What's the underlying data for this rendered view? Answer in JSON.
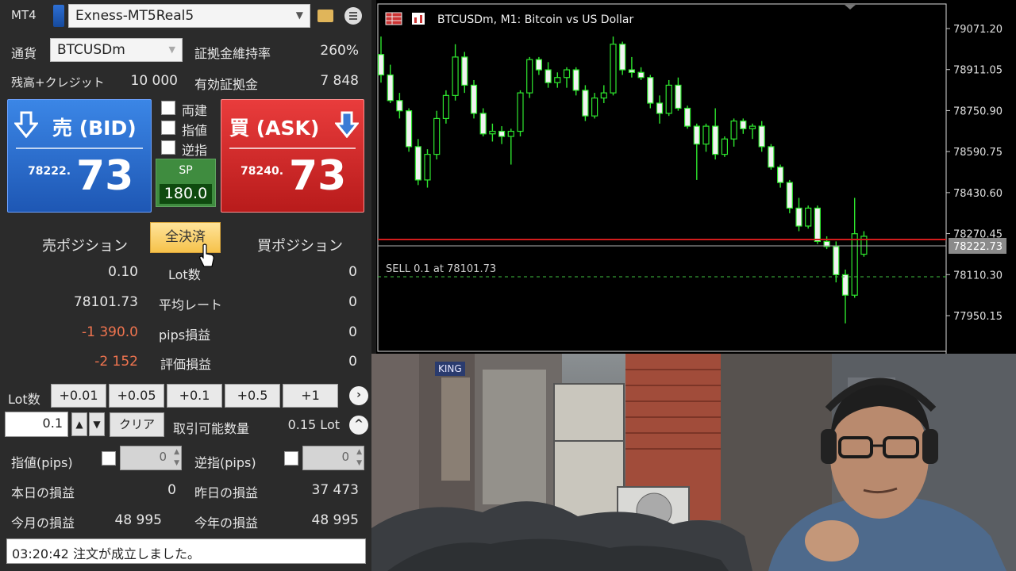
{
  "header": {
    "app": "MT4",
    "account": "Exness-MT5Real5"
  },
  "symbol": {
    "label": "通貨",
    "value": "BTCUSDm"
  },
  "margin_level": {
    "label": "証拠金維持率",
    "value": "260%"
  },
  "balance": {
    "label": "残高+クレジット",
    "value": "10 000"
  },
  "equity": {
    "label": "有効証拠金",
    "value": "7 848"
  },
  "bid": {
    "title": "売 (BID)",
    "small": "78222.",
    "big": "73"
  },
  "ask": {
    "title": "買 (ASK)",
    "small": "78240.",
    "big": "73"
  },
  "options": [
    "両建",
    "指値",
    "逆指"
  ],
  "spread": {
    "label": "SP",
    "value": "180.0"
  },
  "positions": {
    "sell_label": "売ポジション",
    "buy_label": "買ポジション",
    "close_all": "全決済",
    "rows": [
      {
        "sell": "0.10",
        "label": "Lot数",
        "buy": "0"
      },
      {
        "sell": "78101.73",
        "label": "平均レート",
        "buy": "0"
      },
      {
        "sell": "-1 390.0",
        "label": "pips損益",
        "buy": "0"
      },
      {
        "sell": "-2 152",
        "label": "評価損益",
        "buy": "0"
      }
    ]
  },
  "lots": {
    "label": "Lot数",
    "buttons": [
      "+0.01",
      "+0.05",
      "+0.1",
      "+0.5",
      "+1"
    ],
    "input": "0.1",
    "clear": "クリア",
    "available_label": "取引可能数量",
    "available_value": "0.15 Lot"
  },
  "limit": {
    "label": "指値(pips)",
    "value": "0"
  },
  "stop": {
    "label": "逆指(pips)",
    "value": "0"
  },
  "pnl": {
    "today_label": "本日の損益",
    "today": "0",
    "yesterday_label": "昨日の損益",
    "yesterday": "37 473",
    "month_label": "今月の損益",
    "month": "48 995",
    "year_label": "今年の損益",
    "year": "48 995"
  },
  "status_text": "03:20:42 注文が成立しました。",
  "chart": {
    "title": "BTCUSDm, M1:  Bitcoin vs US Dollar",
    "order_label": "SELL 0.1 at 78101.73",
    "price_tag": "78222.73",
    "axis_labels": [
      "79071.20",
      "78911.05",
      "78750.90",
      "78590.75",
      "78430.60",
      "78270.45",
      "78110.30",
      "77950.15"
    ]
  },
  "chart_data": {
    "type": "candlestick",
    "title": "BTCUSDm, M1:  Bitcoin vs US Dollar",
    "y_ticks": [
      79071.2,
      78911.05,
      78750.9,
      78590.75,
      78430.6,
      78270.45,
      78110.3,
      77950.15
    ],
    "ylim": [
      77880,
      79110
    ],
    "current_bid": 78222.73,
    "sell_order": 78101.73,
    "candles": [
      {
        "o": 78970,
        "h": 79040,
        "l": 78860,
        "c": 78890
      },
      {
        "o": 78890,
        "h": 78930,
        "l": 78780,
        "c": 78790
      },
      {
        "o": 78790,
        "h": 78820,
        "l": 78720,
        "c": 78750
      },
      {
        "o": 78750,
        "h": 78760,
        "l": 78590,
        "c": 78610
      },
      {
        "o": 78610,
        "h": 78640,
        "l": 78460,
        "c": 78480
      },
      {
        "o": 78480,
        "h": 78600,
        "l": 78450,
        "c": 78580
      },
      {
        "o": 78580,
        "h": 78750,
        "l": 78560,
        "c": 78720
      },
      {
        "o": 78720,
        "h": 78830,
        "l": 78700,
        "c": 78810
      },
      {
        "o": 78810,
        "h": 79010,
        "l": 78790,
        "c": 78960
      },
      {
        "o": 78960,
        "h": 78980,
        "l": 78820,
        "c": 78850
      },
      {
        "o": 78850,
        "h": 78870,
        "l": 78720,
        "c": 78740
      },
      {
        "o": 78740,
        "h": 78760,
        "l": 78650,
        "c": 78660
      },
      {
        "o": 78660,
        "h": 78700,
        "l": 78630,
        "c": 78670
      },
      {
        "o": 78670,
        "h": 78690,
        "l": 78620,
        "c": 78650
      },
      {
        "o": 78650,
        "h": 78680,
        "l": 78540,
        "c": 78670
      },
      {
        "o": 78670,
        "h": 78830,
        "l": 78650,
        "c": 78820
      },
      {
        "o": 78820,
        "h": 78960,
        "l": 78800,
        "c": 78950
      },
      {
        "o": 78950,
        "h": 78960,
        "l": 78890,
        "c": 78910
      },
      {
        "o": 78910,
        "h": 78940,
        "l": 78840,
        "c": 78860
      },
      {
        "o": 78860,
        "h": 78900,
        "l": 78840,
        "c": 78880
      },
      {
        "o": 78880,
        "h": 78920,
        "l": 78840,
        "c": 78910
      },
      {
        "o": 78910,
        "h": 78920,
        "l": 78810,
        "c": 78830
      },
      {
        "o": 78830,
        "h": 78850,
        "l": 78710,
        "c": 78730
      },
      {
        "o": 78730,
        "h": 78820,
        "l": 78720,
        "c": 78800
      },
      {
        "o": 78800,
        "h": 78850,
        "l": 78780,
        "c": 78820
      },
      {
        "o": 78820,
        "h": 79040,
        "l": 78810,
        "c": 79010
      },
      {
        "o": 79010,
        "h": 79020,
        "l": 78890,
        "c": 78910
      },
      {
        "o": 78910,
        "h": 78960,
        "l": 78880,
        "c": 78900
      },
      {
        "o": 78900,
        "h": 78920,
        "l": 78870,
        "c": 78880
      },
      {
        "o": 78880,
        "h": 78890,
        "l": 78760,
        "c": 78780
      },
      {
        "o": 78780,
        "h": 78810,
        "l": 78700,
        "c": 78740
      },
      {
        "o": 78740,
        "h": 78870,
        "l": 78730,
        "c": 78850
      },
      {
        "o": 78850,
        "h": 78880,
        "l": 78750,
        "c": 78760
      },
      {
        "o": 78760,
        "h": 78770,
        "l": 78680,
        "c": 78690
      },
      {
        "o": 78690,
        "h": 78700,
        "l": 78480,
        "c": 78620
      },
      {
        "o": 78620,
        "h": 78700,
        "l": 78590,
        "c": 78690
      },
      {
        "o": 78690,
        "h": 78760,
        "l": 78560,
        "c": 78580
      },
      {
        "o": 78580,
        "h": 78650,
        "l": 78570,
        "c": 78640
      },
      {
        "o": 78640,
        "h": 78720,
        "l": 78610,
        "c": 78710
      },
      {
        "o": 78710,
        "h": 78720,
        "l": 78660,
        "c": 78680
      },
      {
        "o": 78680,
        "h": 78700,
        "l": 78640,
        "c": 78690
      },
      {
        "o": 78690,
        "h": 78710,
        "l": 78590,
        "c": 78610
      },
      {
        "o": 78610,
        "h": 78620,
        "l": 78520,
        "c": 78530
      },
      {
        "o": 78530,
        "h": 78540,
        "l": 78450,
        "c": 78470
      },
      {
        "o": 78470,
        "h": 78480,
        "l": 78350,
        "c": 78370
      },
      {
        "o": 78370,
        "h": 78410,
        "l": 78280,
        "c": 78300
      },
      {
        "o": 78300,
        "h": 78380,
        "l": 78290,
        "c": 78370
      },
      {
        "o": 78370,
        "h": 78380,
        "l": 78230,
        "c": 78240
      },
      {
        "o": 78240,
        "h": 78260,
        "l": 78210,
        "c": 78220
      },
      {
        "o": 78220,
        "h": 78240,
        "l": 78080,
        "c": 78110
      },
      {
        "o": 78110,
        "h": 78130,
        "l": 77920,
        "c": 78030
      },
      {
        "o": 78030,
        "h": 78410,
        "l": 78020,
        "c": 78270
      },
      {
        "o": 78190,
        "h": 78280,
        "l": 78180,
        "c": 78260
      }
    ]
  }
}
